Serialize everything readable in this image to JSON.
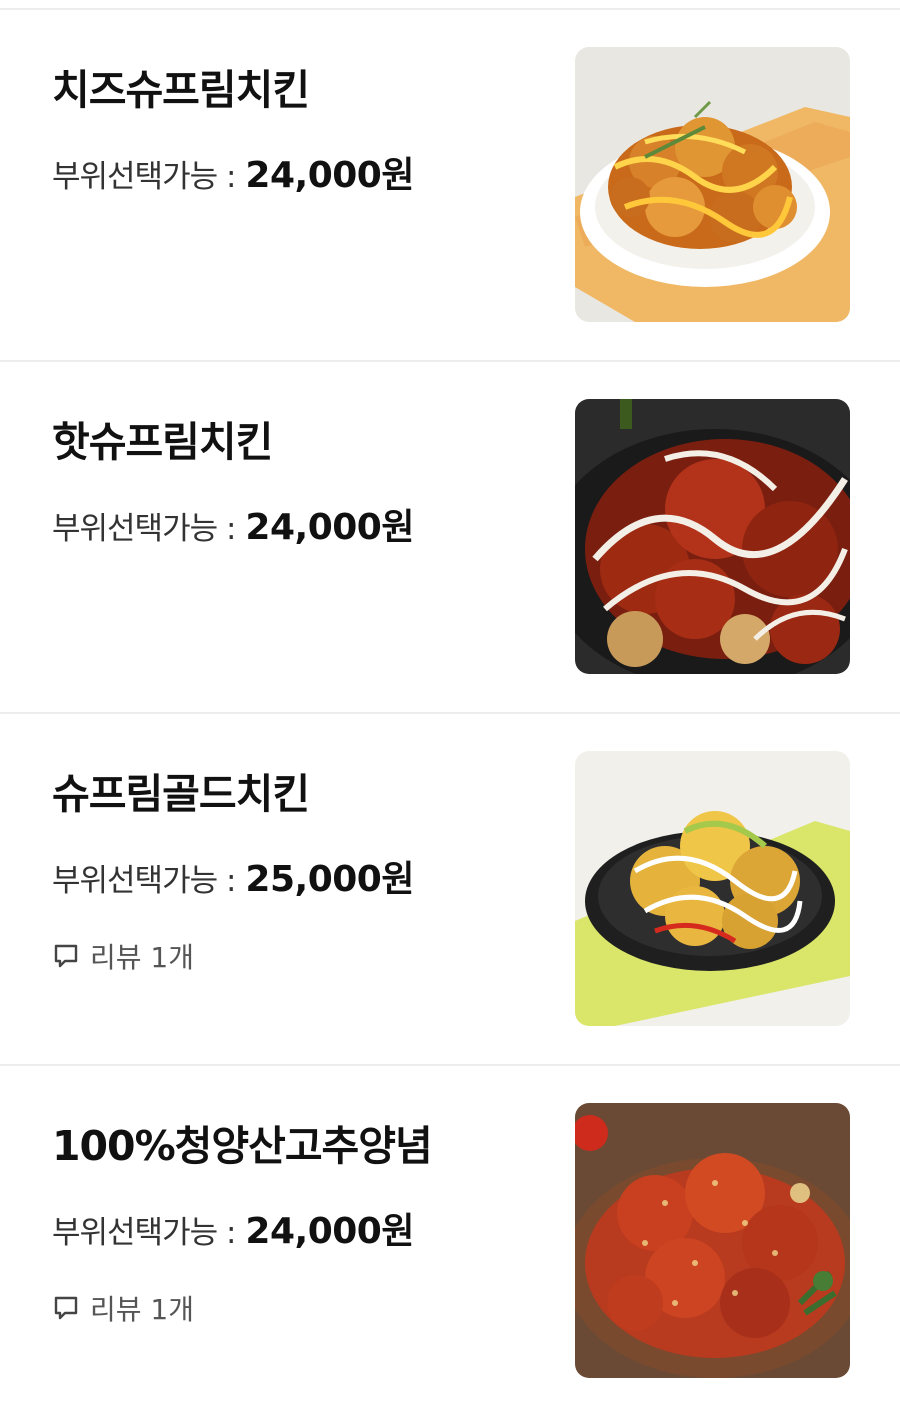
{
  "menu": {
    "items": [
      {
        "name": "치즈슈프림치킨",
        "price_prefix": "부위선택가능 :",
        "price": "24,000원",
        "image_desc": "cheese-supreme-chicken-photo"
      },
      {
        "name": "핫슈프림치킨",
        "price_prefix": "부위선택가능 :",
        "price": "24,000원",
        "image_desc": "hot-supreme-chicken-photo"
      },
      {
        "name": "슈프림골드치킨",
        "price_prefix": "부위선택가능 :",
        "price": "25,000원",
        "review": "리뷰 1개",
        "image_desc": "supreme-gold-chicken-photo"
      },
      {
        "name": "100%청양산고추양념",
        "price_prefix": "부위선택가능 :",
        "price": "24,000원",
        "review": "리뷰 1개",
        "image_desc": "cheongyang-pepper-chicken-photo"
      }
    ]
  },
  "colors": {
    "divider": "#ececec",
    "text_primary": "#111111",
    "text_secondary": "#555555"
  },
  "icons": {
    "review": "speech-bubble-icon"
  }
}
